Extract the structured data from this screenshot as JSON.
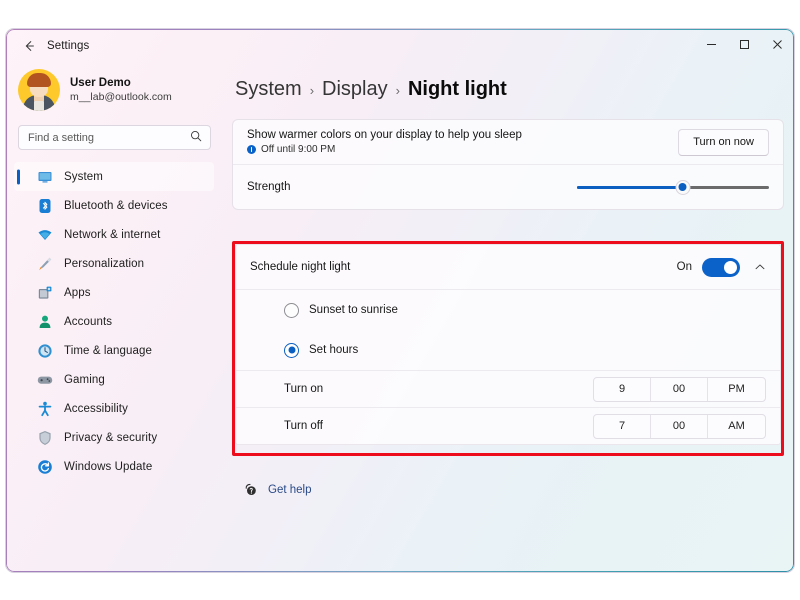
{
  "window": {
    "title": "Settings",
    "back_icon": "back-arrow-icon",
    "controls": {
      "minimize": "–",
      "maximize": "□",
      "close": "×"
    }
  },
  "sidebar": {
    "profile": {
      "name": "User Demo",
      "email": "m__lab@outlook.com",
      "avatar_icon": "user-avatar-icon"
    },
    "search": {
      "placeholder": "Find a setting",
      "value": "",
      "icon": "search-icon"
    },
    "items": [
      {
        "label": "System",
        "icon": "monitor-icon",
        "selected": true
      },
      {
        "label": "Bluetooth & devices",
        "icon": "bluetooth-icon",
        "selected": false
      },
      {
        "label": "Network & internet",
        "icon": "wifi-icon",
        "selected": false
      },
      {
        "label": "Personalization",
        "icon": "paintbrush-icon",
        "selected": false
      },
      {
        "label": "Apps",
        "icon": "apps-grid-icon",
        "selected": false
      },
      {
        "label": "Accounts",
        "icon": "person-icon",
        "selected": false
      },
      {
        "label": "Time & language",
        "icon": "clock-globe-icon",
        "selected": false
      },
      {
        "label": "Gaming",
        "icon": "gamepad-icon",
        "selected": false
      },
      {
        "label": "Accessibility",
        "icon": "accessibility-person-icon",
        "selected": false
      },
      {
        "label": "Privacy & security",
        "icon": "shield-icon",
        "selected": false
      },
      {
        "label": "Windows Update",
        "icon": "update-refresh-icon",
        "selected": false
      }
    ]
  },
  "breadcrumb": {
    "root": "System",
    "parent": "Display",
    "current": "Night light",
    "separator": "›"
  },
  "main": {
    "warmer_colors": {
      "title": "Show warmer colors on your display to help you sleep",
      "status": "Off until 9:00 PM",
      "status_icon": "info-circle-icon",
      "button_label": "Turn on now"
    },
    "strength": {
      "label": "Strength",
      "value_percent": 55
    },
    "schedule": {
      "title": "Schedule night light",
      "toggle_state_label": "On",
      "toggle_on": true,
      "expand_icon": "chevron-up-icon",
      "options": [
        {
          "label": "Sunset to sunrise",
          "selected": false
        },
        {
          "label": "Set hours",
          "selected": true
        }
      ],
      "times": [
        {
          "label": "Turn on",
          "hour": "9",
          "minute": "00",
          "meridiem": "PM"
        },
        {
          "label": "Turn off",
          "hour": "7",
          "minute": "00",
          "meridiem": "AM"
        }
      ]
    },
    "get_help": {
      "label": "Get help",
      "icon": "help-question-icon"
    }
  },
  "annotation": {
    "highlight_color": "#ec0c1b"
  },
  "colors": {
    "accent": "#0b5fc0",
    "toggle_on": "#0b62c9",
    "link": "#2a4a86"
  }
}
